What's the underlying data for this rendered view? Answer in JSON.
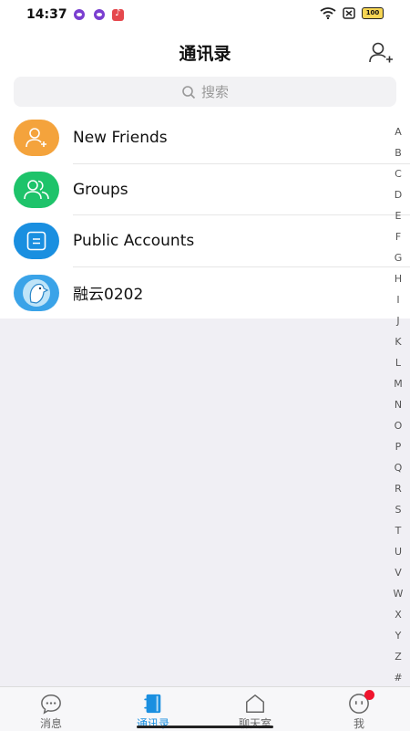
{
  "status_bar": {
    "time": "14:37",
    "battery": "100"
  },
  "header": {
    "title": "通讯录",
    "search_placeholder": "搜索"
  },
  "contacts": [
    {
      "label": "New Friends",
      "icon": "new-friends-icon",
      "color": "#f4a33c"
    },
    {
      "label": "Groups",
      "icon": "groups-icon",
      "color": "#1ec36a"
    },
    {
      "label": "Public Accounts",
      "icon": "public-accounts-icon",
      "color": "#1a8fe0"
    },
    {
      "label": "融云0202",
      "icon": "bird-avatar",
      "color": "#3aa3e8"
    }
  ],
  "index_letters": [
    "A",
    "B",
    "C",
    "D",
    "E",
    "F",
    "G",
    "H",
    "I",
    "J",
    "K",
    "L",
    "M",
    "N",
    "O",
    "P",
    "Q",
    "R",
    "S",
    "T",
    "U",
    "V",
    "W",
    "X",
    "Y",
    "Z",
    "#"
  ],
  "tabs": [
    {
      "label": "消息",
      "icon": "chat-bubble-icon"
    },
    {
      "label": "通讯录",
      "icon": "contacts-book-icon",
      "active": true
    },
    {
      "label": "聊天室",
      "icon": "chatroom-home-icon"
    },
    {
      "label": "我",
      "icon": "me-face-icon"
    }
  ],
  "colors": {
    "accent": "#1a8fe0",
    "background": "#f0eff4",
    "badge": "#f0142d"
  }
}
